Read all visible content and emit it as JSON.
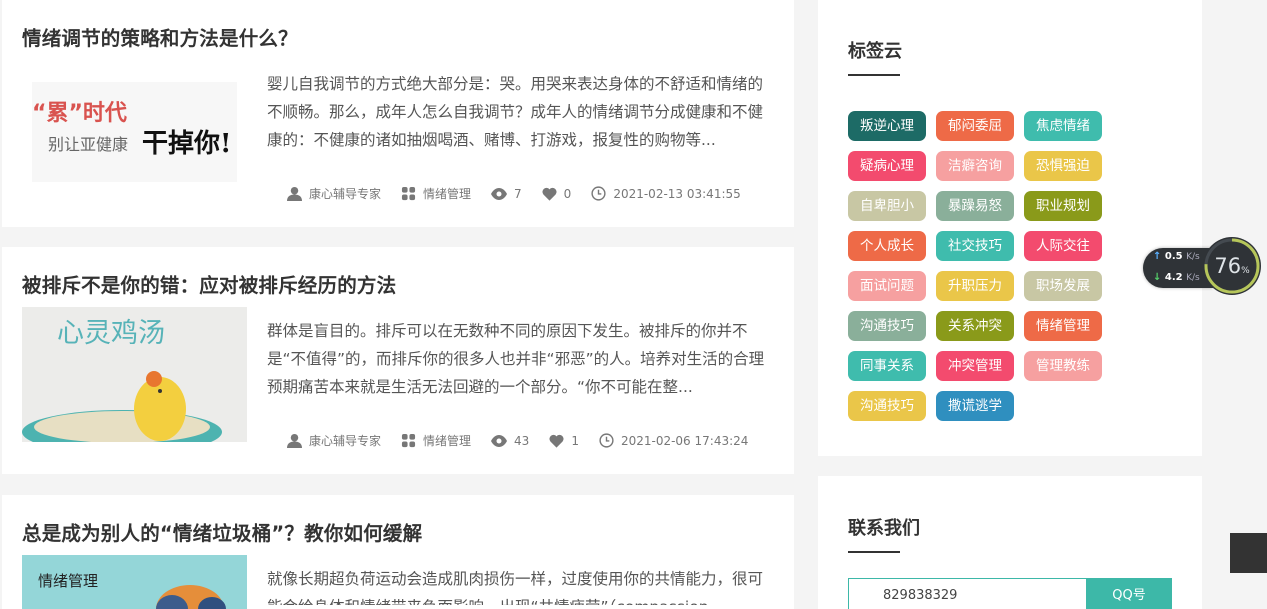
{
  "articles": [
    {
      "title": "情绪调节的策略和方法是什么？",
      "excerpt": "婴儿自我调节的方式绝大部分是：哭。用哭来表达身体的不舒适和情绪的不顺畅。那么，成年人怎么自我调节？成年人的情绪调节分成健康和不健康的：不健康的诸如抽烟喝酒、赌博、打游戏，报复性的购物等...",
      "thumb_text": {
        "line1": "“累”时代",
        "line2": "别让亚健康",
        "line3": "干掉你!"
      },
      "author": "康心辅导专家",
      "category": "情绪管理",
      "views": "7",
      "likes": "0",
      "date": "2021-02-13 03:41:55"
    },
    {
      "title": "被排斥不是你的错：应对被排斥经历的方法",
      "excerpt": "群体是盲目的。排斥可以在无数种不同的原因下发生。被排斥的你并不是“不值得”的，而排斥你的很多人也并非“邪恶”的人。培养对生活的合理预期痛苦本来就是生活无法回避的一个部分。“你不可能在整...",
      "thumb_text": {
        "line1": "心灵鸡汤"
      },
      "author": "康心辅导专家",
      "category": "情绪管理",
      "views": "43",
      "likes": "1",
      "date": "2021-02-06 17:43:24"
    },
    {
      "title": "总是成为别人的“情绪垃圾桶”？教你如何缓解",
      "excerpt": "就像长期超负荷运动会造成肌肉损伤一样，过度使用你的共情能力，很可能会给身体和情绪带来负面影响，出现“共情疲劳”（compassion",
      "thumb_text": {
        "line1": "情绪管理"
      }
    }
  ],
  "tag_cloud": {
    "title": "标签云",
    "tags": [
      {
        "label": "叛逆心理",
        "color": "#1d6b66"
      },
      {
        "label": "郁闷委屈",
        "color": "#ee6a47"
      },
      {
        "label": "焦虑情绪",
        "color": "#3fbcad"
      },
      {
        "label": "疑病心理",
        "color": "#f34b6e"
      },
      {
        "label": "洁癖咨询",
        "color": "#f6a0a0"
      },
      {
        "label": "恐惧强迫",
        "color": "#eac649"
      },
      {
        "label": "自卑胆小",
        "color": "#c8c7a4"
      },
      {
        "label": "暴躁易怒",
        "color": "#8aaf9a"
      },
      {
        "label": "职业规划",
        "color": "#8a9a1a"
      },
      {
        "label": "个人成长",
        "color": "#ee6a47"
      },
      {
        "label": "社交技巧",
        "color": "#3fbcad"
      },
      {
        "label": "人际交往",
        "color": "#f34b6e"
      },
      {
        "label": "面试问题",
        "color": "#f6a0a0"
      },
      {
        "label": "升职压力",
        "color": "#eac649"
      },
      {
        "label": "职场发展",
        "color": "#c8c7a4"
      },
      {
        "label": "沟通技巧",
        "color": "#8aaf9a"
      },
      {
        "label": "关系冲突",
        "color": "#8a9a1a"
      },
      {
        "label": "情绪管理",
        "color": "#ee6a47"
      },
      {
        "label": "同事关系",
        "color": "#3fbcad"
      },
      {
        "label": "冲突管理",
        "color": "#f34b6e"
      },
      {
        "label": "管理教练",
        "color": "#f6a0a0"
      },
      {
        "label": "沟通技巧",
        "color": "#eac649"
      },
      {
        "label": "撒谎逃学",
        "color": "#2f8fbf"
      }
    ]
  },
  "contact": {
    "title": "联系我们",
    "qq_number": "829838329",
    "qq_button": "QQ号"
  },
  "net_monitor": {
    "up_speed": "0.5",
    "down_speed": "4.2",
    "unit": "K/s",
    "cpu_percent": "76",
    "percent_sign": "%"
  },
  "colors": {
    "accent": "#3db8a8"
  }
}
